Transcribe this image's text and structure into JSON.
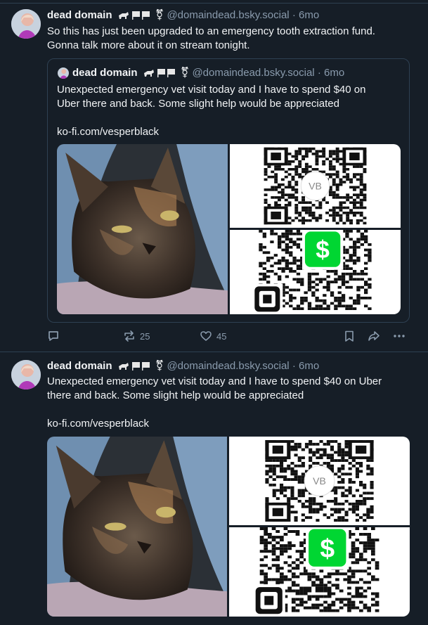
{
  "posts": [
    {
      "author_name": "dead domain",
      "handle": "@domaindead.bsky.social",
      "separator": "·",
      "age": "6mo",
      "text_lines": [
        "So this has just been upgraded to an emergency tooth extraction fund.",
        "Gonna talk more about it on stream tonight."
      ],
      "quote": {
        "author_name": "dead domain",
        "handle": "@domaindead.bsky.social",
        "separator": "·",
        "age": "6mo",
        "text_lines": [
          "Unexpected  emergency vet visit today and I have to spend $40 on",
          "Uber there and back. Some slight help would be appreciated"
        ],
        "link": "ko-fi.com/vesperblack",
        "qr_badge": "VB"
      },
      "reply_count": "",
      "repost_count": "25",
      "like_count": "45"
    },
    {
      "author_name": "dead domain",
      "handle": "@domaindead.bsky.social",
      "separator": "·",
      "age": "6mo",
      "text_lines": [
        "Unexpected  emergency vet visit today and I have to spend $40 on Uber",
        "there and back. Some slight help would be appreciated"
      ],
      "link": "ko-fi.com/vesperblack",
      "qr_badge": "VB"
    }
  ],
  "icons": [
    "reply-icon",
    "repost-icon",
    "like-icon",
    "bookmark-icon",
    "share-icon",
    "more-icon",
    "cash-app-icon",
    "square-icon"
  ],
  "colors": {
    "background": "#161e27",
    "border": "#2e4052",
    "muted_text": "#8a9bad",
    "cash_green": "#00d632"
  }
}
